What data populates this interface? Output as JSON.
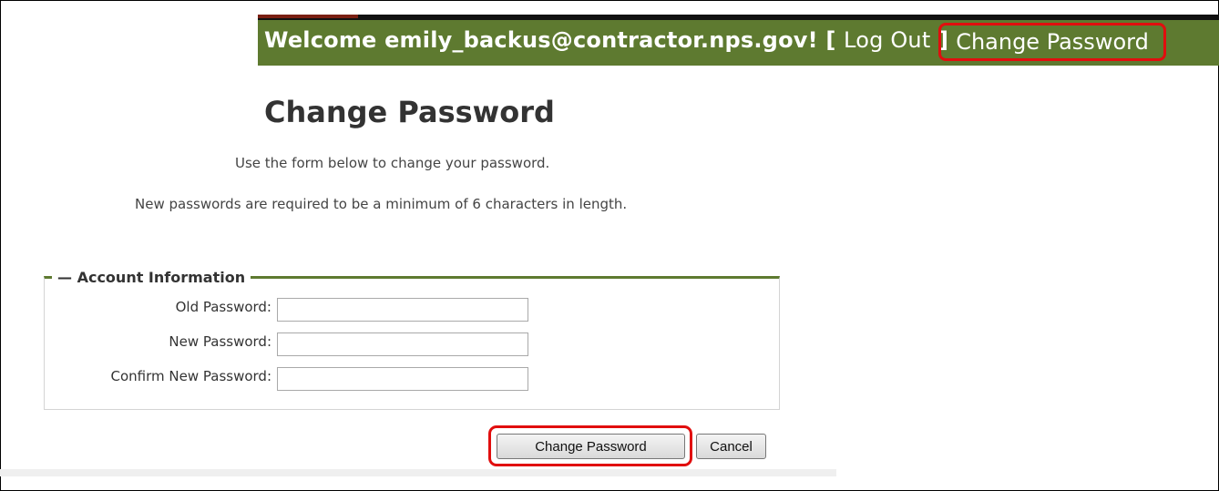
{
  "header": {
    "welcome_prefix": "Welcome emily_backus@contractor.nps.gov!",
    "bracket_open": "[",
    "logout_label": "Log Out",
    "bracket_close": "]",
    "change_password_link": "Change Password"
  },
  "page": {
    "title": "Change Password",
    "instructions": "Use the form below to change your password.",
    "requirement": "New passwords are required to be a minimum of 6 characters in length."
  },
  "form": {
    "legend": "Account Information",
    "old_password_label": "Old Password:",
    "new_password_label": "New Password:",
    "confirm_password_label": "Confirm New Password:",
    "old_password_value": "",
    "new_password_value": "",
    "confirm_password_value": ""
  },
  "buttons": {
    "submit_label": "Change Password",
    "cancel_label": "Cancel"
  },
  "colors": {
    "header_green": "#5e7a30",
    "highlight_red": "#e10e0e"
  }
}
